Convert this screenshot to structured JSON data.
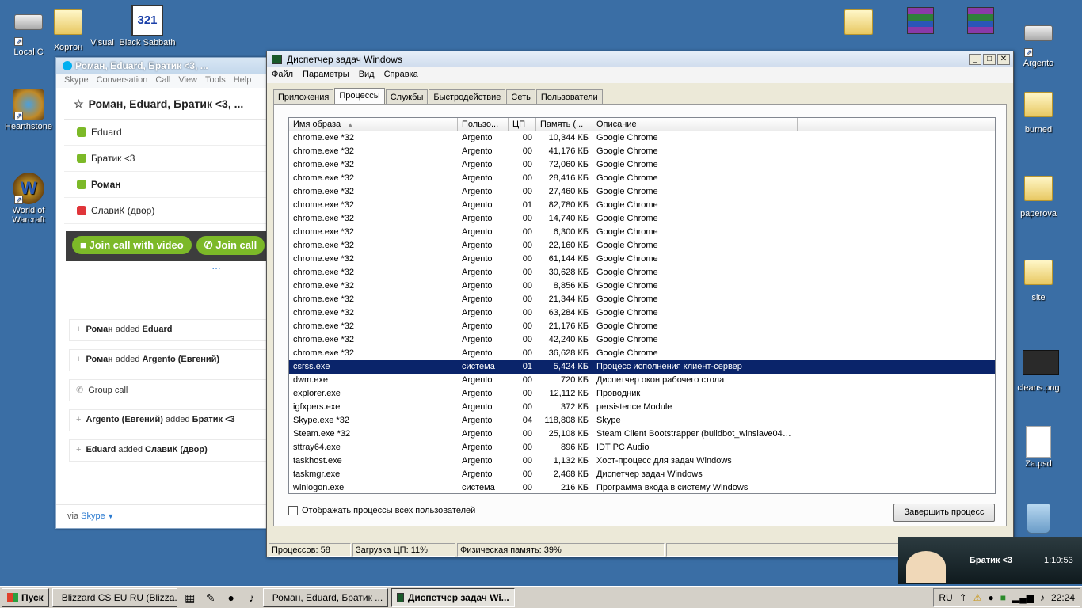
{
  "desktop_icons": [
    {
      "label": "Local C",
      "type": "drive"
    },
    {
      "label": "Хортон",
      "type": "folder"
    },
    {
      "label": "Visual",
      "type": "folder"
    },
    {
      "label": "Black Sabbath",
      "type": "app321"
    },
    {
      "label": "Hearthstone",
      "type": "game"
    },
    {
      "label": "World of Warcraft",
      "type": "game"
    },
    {
      "label": "Argento",
      "type": "drive"
    },
    {
      "label": "burned",
      "type": "folder"
    },
    {
      "label": "paperova",
      "type": "folder"
    },
    {
      "label": "site",
      "type": "folder"
    },
    {
      "label": "cleans.png",
      "type": "image"
    },
    {
      "label": "Za.psd",
      "type": "file"
    }
  ],
  "skype": {
    "title": "Роман, Eduard, Братик <3, ...",
    "menu": [
      "Skype",
      "Conversation",
      "Call",
      "View",
      "Tools",
      "Help"
    ],
    "conversation_title": "Роман, Eduard, Братик <3, ...",
    "contacts": [
      {
        "name": "Eduard",
        "status": "online"
      },
      {
        "name": "Братик <3",
        "status": "online"
      },
      {
        "name": "Роман",
        "status": "online",
        "bold": true
      },
      {
        "name": "СлавиК (двор)",
        "status": "busy"
      }
    ],
    "join_video": "Join call with video",
    "join_call": "Join call",
    "events": [
      {
        "a": "Роман",
        "verb": " added ",
        "b": "Eduard"
      },
      {
        "a": "Роман",
        "verb": " added ",
        "b": "Argento (Евгений)"
      },
      {
        "a": "",
        "verb": "Group call",
        "b": ""
      },
      {
        "a": "Argento (Евгений)",
        "verb": " added ",
        "b": "Братик <3"
      },
      {
        "a": "Eduard",
        "verb": " added ",
        "b": "СлавиК (двор)"
      }
    ],
    "footer_via": "via",
    "footer_link": "Skype"
  },
  "taskmgr": {
    "title": "Диспетчер задач Windows",
    "menu": [
      "Файл",
      "Параметры",
      "Вид",
      "Справка"
    ],
    "tabs": [
      "Приложения",
      "Процессы",
      "Службы",
      "Быстродействие",
      "Сеть",
      "Пользователи"
    ],
    "active_tab": 1,
    "columns": [
      "Имя образа",
      "Пользо...",
      "ЦП",
      "Память (...",
      "Описание"
    ],
    "rows": [
      [
        "chrome.exe *32",
        "Argento",
        "00",
        "10,344 КБ",
        "Google Chrome"
      ],
      [
        "chrome.exe *32",
        "Argento",
        "00",
        "41,176 КБ",
        "Google Chrome"
      ],
      [
        "chrome.exe *32",
        "Argento",
        "00",
        "72,060 КБ",
        "Google Chrome"
      ],
      [
        "chrome.exe *32",
        "Argento",
        "00",
        "28,416 КБ",
        "Google Chrome"
      ],
      [
        "chrome.exe *32",
        "Argento",
        "00",
        "27,460 КБ",
        "Google Chrome"
      ],
      [
        "chrome.exe *32",
        "Argento",
        "01",
        "82,780 КБ",
        "Google Chrome"
      ],
      [
        "chrome.exe *32",
        "Argento",
        "00",
        "14,740 КБ",
        "Google Chrome"
      ],
      [
        "chrome.exe *32",
        "Argento",
        "00",
        "6,300 КБ",
        "Google Chrome"
      ],
      [
        "chrome.exe *32",
        "Argento",
        "00",
        "22,160 КБ",
        "Google Chrome"
      ],
      [
        "chrome.exe *32",
        "Argento",
        "00",
        "61,144 КБ",
        "Google Chrome"
      ],
      [
        "chrome.exe *32",
        "Argento",
        "00",
        "30,628 КБ",
        "Google Chrome"
      ],
      [
        "chrome.exe *32",
        "Argento",
        "00",
        "8,856 КБ",
        "Google Chrome"
      ],
      [
        "chrome.exe *32",
        "Argento",
        "00",
        "21,344 КБ",
        "Google Chrome"
      ],
      [
        "chrome.exe *32",
        "Argento",
        "00",
        "63,284 КБ",
        "Google Chrome"
      ],
      [
        "chrome.exe *32",
        "Argento",
        "00",
        "21,176 КБ",
        "Google Chrome"
      ],
      [
        "chrome.exe *32",
        "Argento",
        "00",
        "42,240 КБ",
        "Google Chrome"
      ],
      [
        "chrome.exe *32",
        "Argento",
        "00",
        "36,628 КБ",
        "Google Chrome"
      ],
      [
        "csrss.exe",
        "система",
        "01",
        "5,424 КБ",
        "Процесс исполнения клиент-сервер"
      ],
      [
        "dwm.exe",
        "Argento",
        "00",
        "720 КБ",
        "Диспетчер окон рабочего стола"
      ],
      [
        "explorer.exe",
        "Argento",
        "00",
        "12,112 КБ",
        "Проводник"
      ],
      [
        "igfxpers.exe",
        "Argento",
        "00",
        "372 КБ",
        "persistence Module"
      ],
      [
        "Skype.exe *32",
        "Argento",
        "04",
        "118,808 КБ",
        "Skype"
      ],
      [
        "Steam.exe *32",
        "Argento",
        "00",
        "25,108 КБ",
        "Steam Client Bootstrapper (buildbot_winslave04_..."
      ],
      [
        "sttray64.exe",
        "Argento",
        "00",
        "896 КБ",
        "IDT PC Audio"
      ],
      [
        "taskhost.exe",
        "Argento",
        "00",
        "1,132 КБ",
        "Хост-процесс для задач Windows"
      ],
      [
        "taskmgr.exe",
        "Argento",
        "00",
        "2,468 КБ",
        "Диспетчер задач Windows"
      ],
      [
        "winlogon.exe",
        "система",
        "00",
        "216 КБ",
        "Программа входа в систему Windows"
      ]
    ],
    "selected_row": 17,
    "show_all_label": "Отображать процессы всех пользователей",
    "end_process": "Завершить процесс",
    "status": {
      "processes": "Процессов: 58",
      "cpu": "Загрузка ЦП: 11%",
      "memory": "Физическая память: 39%"
    }
  },
  "notification": {
    "name": "Братик <3",
    "time": "1:10:53"
  },
  "taskbar": {
    "start": "Пуск",
    "buttons": [
      {
        "label": "Blizzard CS EU RU (Blizza...",
        "active": false
      },
      {
        "label": "Роман, Eduard, Братик ...",
        "active": false
      },
      {
        "label": "Диспетчер задач Wi...",
        "active": true
      }
    ],
    "lang": "RU",
    "clock": "22:24"
  }
}
